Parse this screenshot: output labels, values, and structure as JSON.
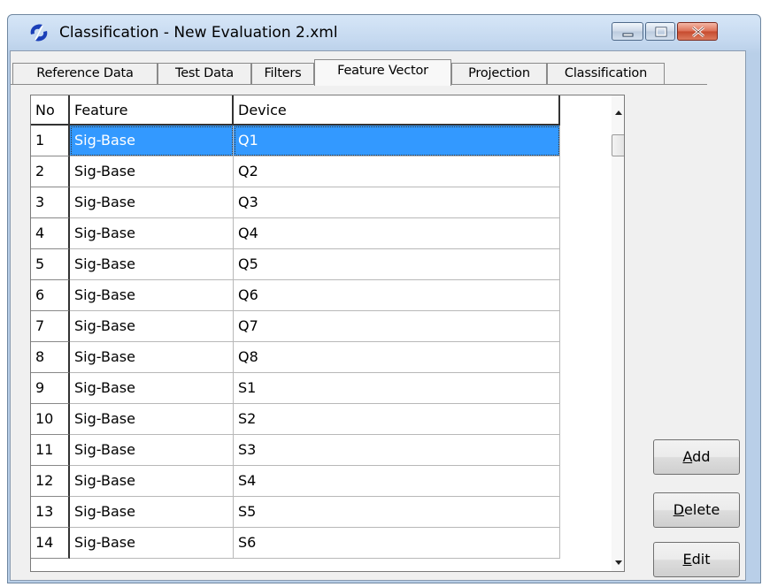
{
  "window": {
    "title": "Classification - New Evaluation 2.xml",
    "accent": "#3399ff"
  },
  "icons": {
    "app": "app-logo-icon",
    "minimize": "minimize-icon",
    "maximize": "maximize-icon",
    "close": "close-icon",
    "scroll_up": "scroll-up-icon",
    "scroll_down": "scroll-down-icon"
  },
  "tabs": [
    {
      "label": "Reference Data"
    },
    {
      "label": "Test Data"
    },
    {
      "label": "Filters"
    },
    {
      "label": "Feature Vector",
      "active": true
    },
    {
      "label": "Projection"
    },
    {
      "label": "Classification"
    }
  ],
  "grid": {
    "columns": [
      "No",
      "Feature",
      "Device"
    ],
    "selected_row": 0,
    "rows": [
      {
        "no": "1",
        "feature": "Sig-Base",
        "device": "Q1"
      },
      {
        "no": "2",
        "feature": "Sig-Base",
        "device": "Q2"
      },
      {
        "no": "3",
        "feature": "Sig-Base",
        "device": "Q3"
      },
      {
        "no": "4",
        "feature": "Sig-Base",
        "device": "Q4"
      },
      {
        "no": "5",
        "feature": "Sig-Base",
        "device": "Q5"
      },
      {
        "no": "6",
        "feature": "Sig-Base",
        "device": "Q6"
      },
      {
        "no": "7",
        "feature": "Sig-Base",
        "device": "Q7"
      },
      {
        "no": "8",
        "feature": "Sig-Base",
        "device": "Q8"
      },
      {
        "no": "9",
        "feature": "Sig-Base",
        "device": "S1"
      },
      {
        "no": "10",
        "feature": "Sig-Base",
        "device": "S2"
      },
      {
        "no": "11",
        "feature": "Sig-Base",
        "device": "S3"
      },
      {
        "no": "12",
        "feature": "Sig-Base",
        "device": "S4"
      },
      {
        "no": "13",
        "feature": "Sig-Base",
        "device": "S5"
      },
      {
        "no": "14",
        "feature": "Sig-Base",
        "device": "S6"
      }
    ]
  },
  "buttons": {
    "add": {
      "mnemonic": "A",
      "rest": "dd"
    },
    "delete": {
      "mnemonic": "D",
      "rest": "elete"
    },
    "edit": {
      "mnemonic": "E",
      "rest": "dit"
    }
  }
}
